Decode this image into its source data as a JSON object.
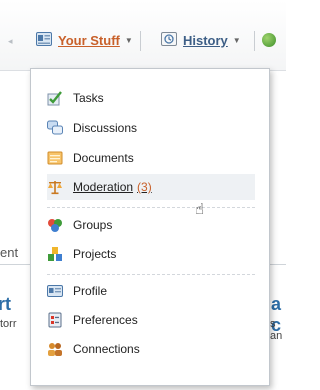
{
  "nav": {
    "your_stuff": "Your Stuff",
    "history": "History"
  },
  "menu": {
    "items": [
      {
        "label": "Tasks",
        "icon": "tasks-icon"
      },
      {
        "label": "Discussions",
        "icon": "discussions-icon"
      },
      {
        "label": "Documents",
        "icon": "documents-icon"
      },
      {
        "label": "Moderation",
        "count": "(3)",
        "icon": "moderation-icon"
      },
      {
        "label": "Groups",
        "icon": "groups-icon"
      },
      {
        "label": "Projects",
        "icon": "projects-icon"
      },
      {
        "label": "Profile",
        "icon": "profile-icon"
      },
      {
        "label": "Preferences",
        "icon": "preferences-icon"
      },
      {
        "label": "Connections",
        "icon": "connections-icon"
      }
    ]
  },
  "background": {
    "left_fragment": "ent",
    "left_big": "rt",
    "left_small": "torr",
    "right_big": "a c",
    "right_small": "s an"
  },
  "colors": {
    "accent": "#c8602a",
    "link": "#3d5e86"
  }
}
